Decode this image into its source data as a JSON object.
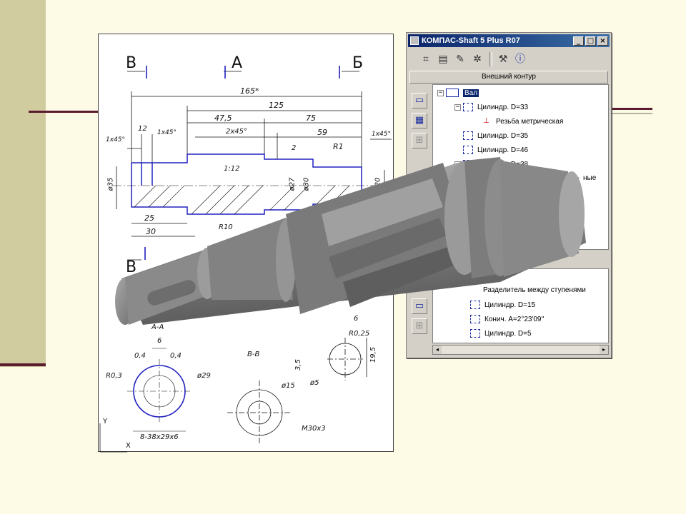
{
  "window": {
    "title": "КОМПАС-Shaft 5 Plus R07",
    "min_label": "_",
    "max_label": "□",
    "close_label": "×",
    "header_label": "Внешний контур"
  },
  "toolbar": {
    "icons": [
      "new-element-icon",
      "save-icon",
      "edit-icon",
      "parameters-icon",
      "calculation-icon",
      "info-icon"
    ],
    "glyphs": [
      "⌗",
      "▤",
      "✎",
      "✲",
      "⚒",
      "ⓘ"
    ]
  },
  "tree": {
    "root": "Вал",
    "items": [
      {
        "label": "Цилиндр. D=33",
        "toggle": "−"
      },
      {
        "label": "Резьба метрическая"
      },
      {
        "label": "Цилиндр. D=35"
      },
      {
        "label": "Цилиндр. D=46"
      },
      {
        "label": "Цилиндр. D=38",
        "toggle": "−"
      },
      {
        "label": "ные"
      }
    ],
    "lower_items": [
      {
        "label": "Разделитель между ступенями"
      },
      {
        "label": "Цилиндр. D=15"
      },
      {
        "label": "Конич. A=2°23'09''"
      },
      {
        "label": "Цилиндр. D=5"
      }
    ]
  },
  "drawing": {
    "section_letters": {
      "b_top": "В",
      "a_top": "А",
      "be_top": "Б",
      "b_left": "В"
    },
    "dims": {
      "d165": "165*",
      "d125": "125",
      "d47": "47,5",
      "d75": "75",
      "d12": "12",
      "c1x45a": "1x45°",
      "c1x45b": "1x45°",
      "c2x45": "2x45°",
      "d59": "59",
      "c1x45c": "1x45°",
      "d2": "2",
      "r1": "R1",
      "phi35": "ø35",
      "taper": "1:12",
      "phi27": "ø27",
      "phi30": "ø30",
      "phi20": "ø20",
      "d25": "25",
      "d30": "30",
      "r10": "R10",
      "c1x45d": "1x45°",
      "aa": "А-А",
      "d6": "6",
      "d04a": "0,4",
      "d04b": "0,4",
      "r03": "R0,3",
      "phi29": "ø29",
      "spline": "8-38x29x6",
      "vv": "В-В",
      "phi15": "ø15",
      "m30": "M30x3",
      "d6b": "6",
      "r025": "R0,25",
      "d35": "3,5",
      "phi5": "ø5",
      "d195": "19,5",
      "axis_y": "Y",
      "axis_x": "X"
    }
  },
  "colors": {
    "background": "#fdfbe6",
    "band": "#d0cca0",
    "accent_line": "#5b1a2e",
    "drawing_blue": "#2020c0",
    "title_bar": "#0a246a"
  }
}
